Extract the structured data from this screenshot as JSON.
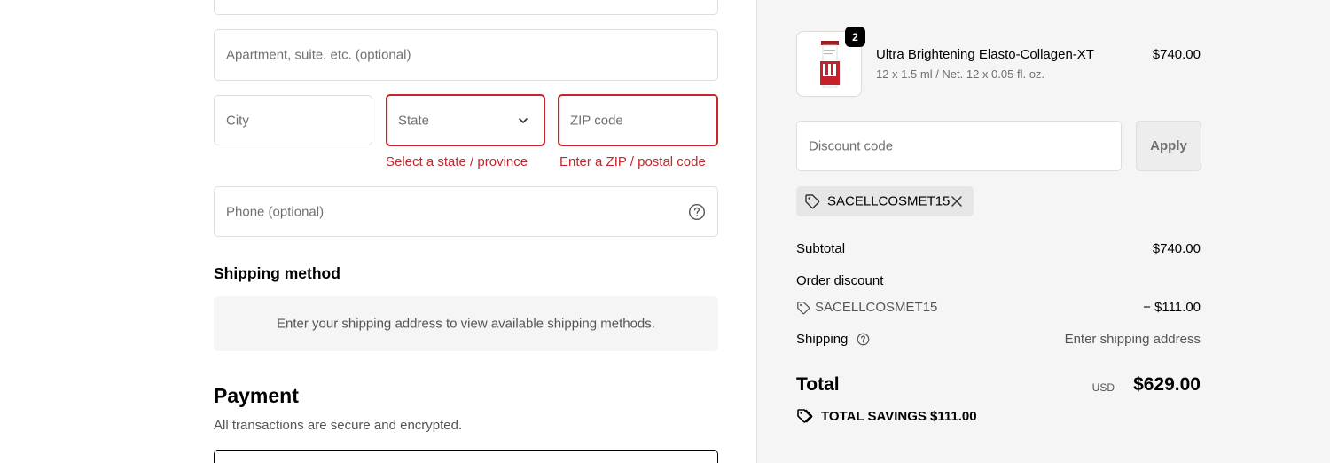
{
  "form": {
    "apartment_placeholder": "Apartment, suite, etc. (optional)",
    "city_placeholder": "City",
    "state_value": "State",
    "state_error": "Select a state / province",
    "zip_placeholder": "ZIP code",
    "zip_error": "Enter a ZIP / postal code",
    "phone_placeholder": "Phone (optional)"
  },
  "shipping_method": {
    "title": "Shipping method",
    "message": "Enter your shipping address to view available shipping methods."
  },
  "payment": {
    "title": "Payment",
    "subtitle": "All transactions are secure and encrypted."
  },
  "summary": {
    "product": {
      "quantity": "2",
      "name": "Ultra Brightening Elasto-Collagen-XT",
      "variant": "12 x 1.5 ml / Net. 12 x 0.05 fl. oz.",
      "price": "$740.00"
    },
    "discount": {
      "placeholder": "Discount code",
      "apply_label": "Apply",
      "applied_code": "SACELLCOSMET15"
    },
    "subtotal_label": "Subtotal",
    "subtotal_value": "$740.00",
    "order_discount_label": "Order discount",
    "order_discount_code": "SACELLCOSMET15",
    "order_discount_value": "− $111.00",
    "shipping_label": "Shipping",
    "shipping_value": "Enter shipping address",
    "total_label": "Total",
    "total_currency": "USD",
    "total_value": "$629.00",
    "savings_label": "TOTAL SAVINGS",
    "savings_value": "$111.00"
  },
  "colors": {
    "error": "#c4262e",
    "summary_bg": "#f5f5f5"
  }
}
